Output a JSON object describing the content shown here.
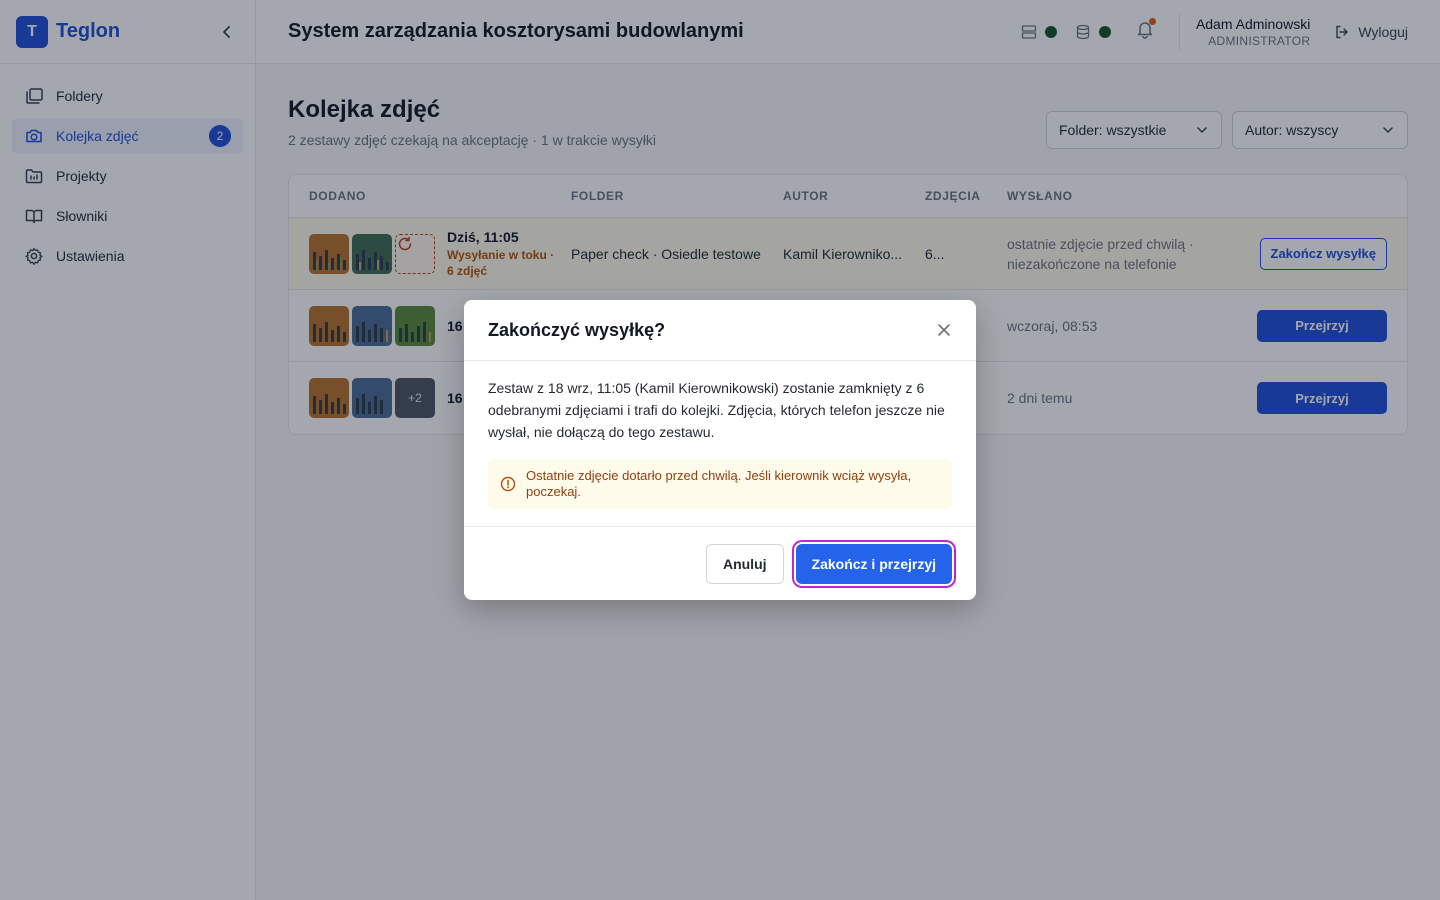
{
  "app": {
    "brand_letter": "T",
    "brand_name": "Teglon",
    "title": "System zarządzania kosztorysami budowlanymi"
  },
  "sidebar": {
    "items": [
      {
        "label": "Foldery",
        "icon": "folders-icon"
      },
      {
        "label": "Kolejka zdjęć",
        "icon": "camera-icon",
        "badge": "2",
        "active": true
      },
      {
        "label": "Projekty",
        "icon": "project-folder-icon"
      },
      {
        "label": "Słowniki",
        "icon": "book-icon"
      },
      {
        "label": "Ustawienia",
        "icon": "gear-icon"
      }
    ]
  },
  "header": {
    "user_name": "Adam Adminowski",
    "user_role": "ADMINISTRATOR",
    "logout_label": "Wyloguj",
    "status_colors": {
      "server": "#14532d",
      "database": "#14532d"
    },
    "notification_dot_color": "#ea580c"
  },
  "main": {
    "title": "Kolejka zdjęć",
    "subtitle": "2 zestawy zdjęć czekają na akceptację · 1 w trakcie wysyłki",
    "filters": {
      "folder": "Folder: wszystkie",
      "author": "Autor: wszyscy"
    },
    "table": {
      "columns": [
        "DODANO",
        "FOLDER",
        "AUTOR",
        "ZDJĘCIA",
        "WYSŁANO"
      ],
      "rows": [
        {
          "date": "Dziś, 11:05",
          "status": "Wysyłanie w toku · 6 zdjęć",
          "folder": "Paper check · Osiedle testowe",
          "author": "Kamil Kierowniko...",
          "photos": "6...",
          "sent": "ostatnie zdjęcie przed chwilą · niezakończone na telefonie",
          "action": "Zakończ wysyłkę"
        },
        {
          "date": "16",
          "sent": "wczoraj, 08:53",
          "action": "Przejrzyj"
        },
        {
          "date": "16",
          "more": "+2",
          "sent": "2 dni temu",
          "action": "Przejrzyj"
        }
      ]
    }
  },
  "dialog": {
    "title": "Zakończyć wysyłkę?",
    "body": "Zestaw z 18 wrz, 11:05 (Kamil Kierownikowski) zostanie zamknięty z 6 odebranymi zdjęciami i trafi do kolejki. Zdjęcia, których telefon jeszcze nie wysłał, nie dołączą do tego zestawu.",
    "warning": "Ostatnie zdjęcie dotarło przed chwilą. Jeśli kierownik wciąż wysyła, poczekaj.",
    "cancel_label": "Anuluj",
    "confirm_label": "Zakończ i przejrzyj"
  },
  "colors": {
    "accent": "#1d4ed8",
    "warning_text": "#92400e",
    "warning_bg": "#fffbeb",
    "focus_ring": "#c026d3"
  }
}
